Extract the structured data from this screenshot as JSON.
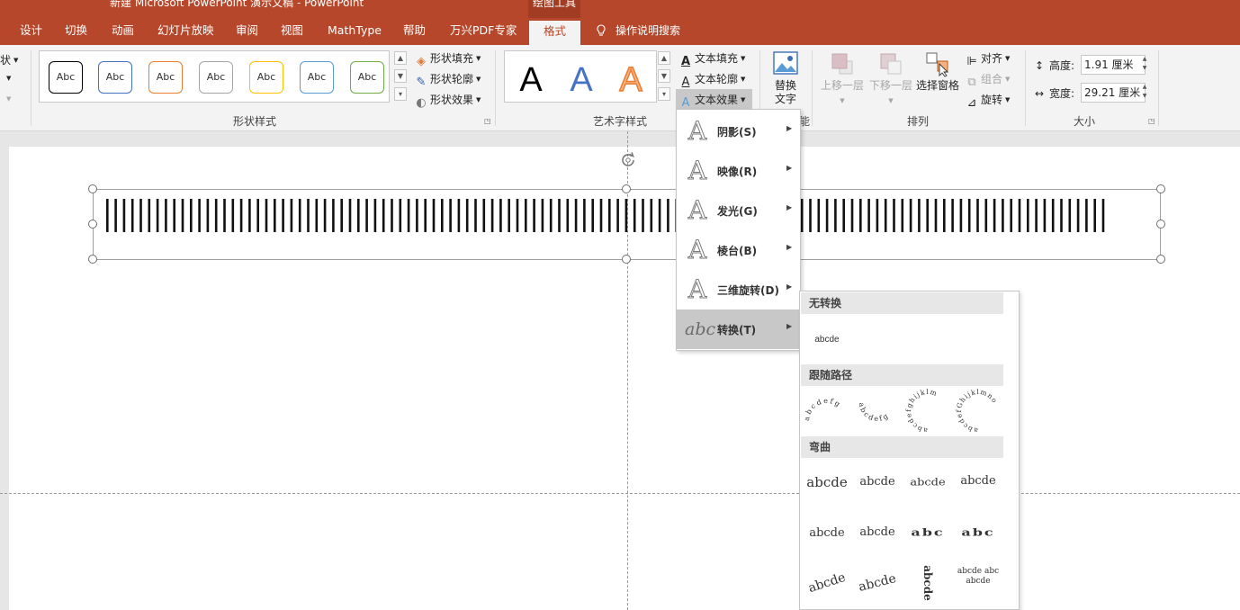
{
  "window": {
    "title": "新建 Microsoft PowerPoint 演示文稿  -  PowerPoint",
    "context_tab_group": "绘图工具"
  },
  "tabs": [
    "设计",
    "切换",
    "动画",
    "幻灯片放映",
    "审阅",
    "视图",
    "MathType",
    "帮助",
    "万兴PDF专家",
    "格式"
  ],
  "active_tab": "格式",
  "tell_me": "操作说明搜索",
  "ribbon": {
    "left_cut": [
      "状",
      "",
      ""
    ],
    "shape_styles": {
      "label": "形状样式",
      "thumb_text": "Abc",
      "thumb_colors": [
        "#000000",
        "#4472c4",
        "#ed7d31",
        "#a5a5a5",
        "#ffc000",
        "#5b9bd5",
        "#70ad47"
      ],
      "fill": "形状填充",
      "outline": "形状轮廓",
      "effects": "形状效果"
    },
    "wordart_styles": {
      "label": "艺术字样式",
      "thumbs": [
        {
          "letter": "A",
          "color": "#000000"
        },
        {
          "letter": "A",
          "color": "#4472c4"
        },
        {
          "letter": "A",
          "color": "#ed7d31"
        }
      ],
      "text_fill": "文本填充",
      "text_outline": "文本轮廓",
      "text_effects": "文本效果"
    },
    "accessibility": {
      "alt_text_line1": "替换",
      "alt_text_line2": "文字",
      "group_label_fragment": "能"
    },
    "arrange": {
      "label": "排列",
      "bring_forward": "上移一层",
      "send_backward": "下移一层",
      "selection_pane": "选择窗格",
      "align": "对齐",
      "group": "组合",
      "rotate": "旋转"
    },
    "size": {
      "label": "大小",
      "height_label": "高度:",
      "height_value": "1.91 厘米",
      "width_label": "宽度:",
      "width_value": "29.21 厘米"
    }
  },
  "text_effects_menu": {
    "items": [
      {
        "label": "阴影(S)",
        "icon": "A"
      },
      {
        "label": "映像(R)",
        "icon": "A"
      },
      {
        "label": "发光(G)",
        "icon": "A"
      },
      {
        "label": "棱台(B)",
        "icon": "A"
      },
      {
        "label": "三维旋转(D)",
        "icon": "A"
      },
      {
        "label": "转换(T)",
        "icon": "abc"
      }
    ],
    "highlighted": "转换(T)"
  },
  "transform_submenu": {
    "sections": [
      {
        "title": "无转换"
      },
      {
        "title": "跟随路径"
      },
      {
        "title": "弯曲"
      }
    ],
    "no_transform_sample": "abcde",
    "follow_path_samples": [
      "abcdefg",
      "abcdefg",
      "abcdefghijklm",
      "abcdefGhijklmno"
    ],
    "warp_samples": [
      "abcde",
      "abcde",
      "abcde",
      "abcde",
      "abcde",
      "abcde",
      "abc",
      "abc",
      "abcde",
      "abcde",
      "abcde",
      "abcde abc abcde"
    ]
  }
}
